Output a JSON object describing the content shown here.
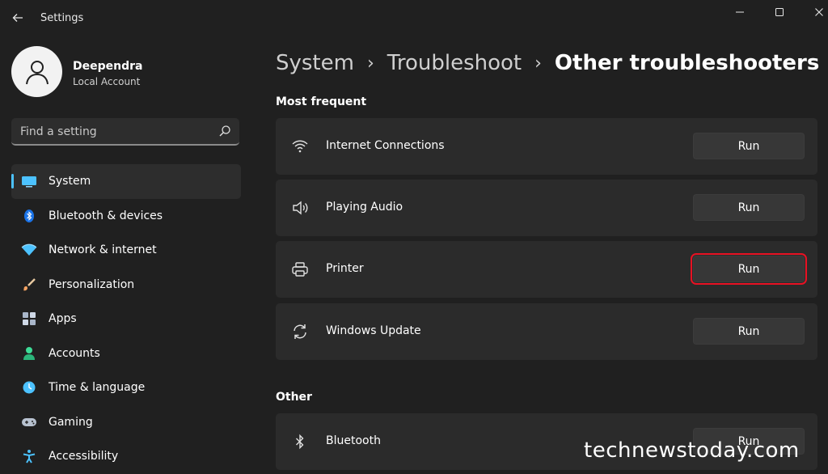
{
  "window": {
    "title": "Settings"
  },
  "profile": {
    "name": "Deependra",
    "account_type": "Local Account"
  },
  "search": {
    "placeholder": "Find a setting"
  },
  "sidebar": {
    "items": [
      {
        "label": "System",
        "icon": "system-icon",
        "active": true
      },
      {
        "label": "Bluetooth & devices",
        "icon": "bluetooth-icon"
      },
      {
        "label": "Network & internet",
        "icon": "network-icon"
      },
      {
        "label": "Personalization",
        "icon": "brush-icon"
      },
      {
        "label": "Apps",
        "icon": "apps-icon"
      },
      {
        "label": "Accounts",
        "icon": "accounts-icon"
      },
      {
        "label": "Time & language",
        "icon": "globe-clock-icon"
      },
      {
        "label": "Gaming",
        "icon": "gamepad-icon"
      },
      {
        "label": "Accessibility",
        "icon": "accessibility-icon"
      }
    ]
  },
  "breadcrumb": {
    "items": [
      "System",
      "Troubleshoot"
    ],
    "current": "Other troubleshooters"
  },
  "sections": {
    "most_frequent": {
      "label": "Most frequent",
      "items": [
        {
          "label": "Internet Connections",
          "icon": "wifi-icon",
          "button": "Run"
        },
        {
          "label": "Playing Audio",
          "icon": "speaker-icon",
          "button": "Run"
        },
        {
          "label": "Printer",
          "icon": "printer-icon",
          "button": "Run",
          "highlighted": true
        },
        {
          "label": "Windows Update",
          "icon": "refresh-icon",
          "button": "Run"
        }
      ]
    },
    "other": {
      "label": "Other",
      "items": [
        {
          "label": "Bluetooth",
          "icon": "bluetooth-icon",
          "button": "Run"
        }
      ]
    }
  },
  "watermark": "technewstoday.com",
  "colors": {
    "accent": "#4cc2ff",
    "highlight": "#e81123",
    "background": "#202020",
    "card": "#2b2b2b"
  }
}
